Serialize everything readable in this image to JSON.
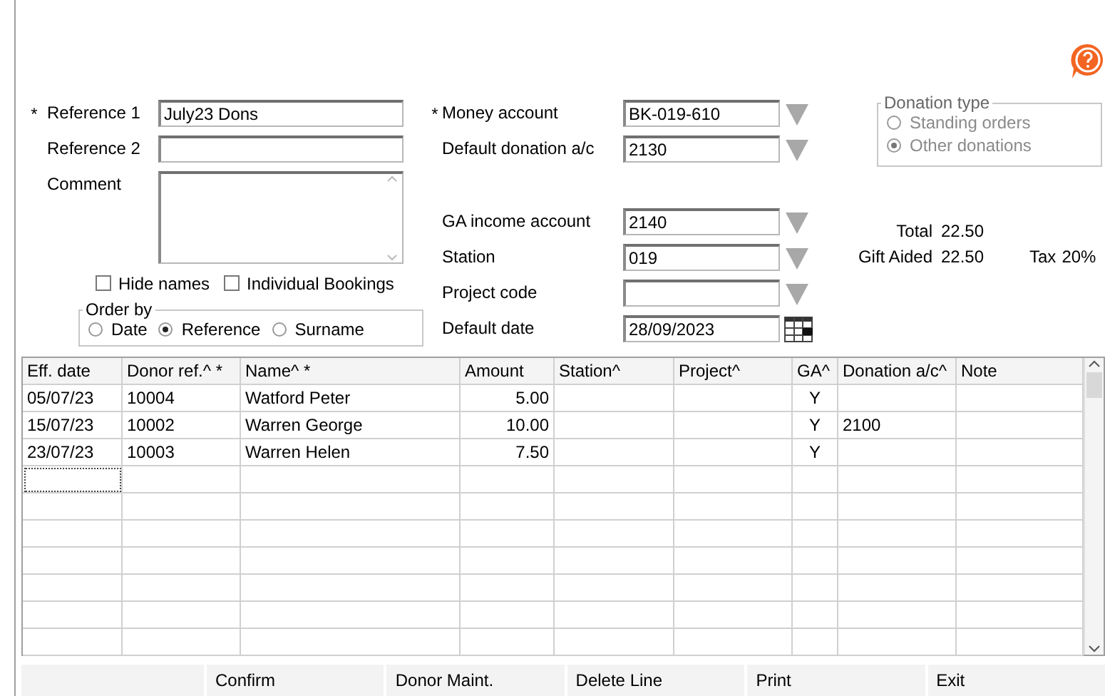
{
  "reference_fields": [
    {
      "kind": "text",
      "label": "Reference 1",
      "marker": "*",
      "value": "July23 Dons"
    },
    {
      "kind": "text",
      "label": "Reference 2"
    },
    {
      "kind": "memo",
      "label": "Comment"
    }
  ],
  "checkboxes": [
    {
      "label": "Hide names",
      "checked": false
    },
    {
      "label": "Individual Bookings",
      "checked": false
    }
  ],
  "order_by": {
    "title": "Order by",
    "options": [
      {
        "label": "Date",
        "selected": false
      },
      {
        "label": "Reference",
        "selected": true
      },
      {
        "label": "Surname",
        "selected": false
      }
    ]
  },
  "account_fields": [
    {
      "kind": "dropdown",
      "label": "Money account",
      "marker": "*",
      "value": "BK-019-610"
    },
    {
      "kind": "dropdown",
      "label": "Default donation a/c",
      "value": "2130"
    }
  ],
  "detail_fields": [
    {
      "kind": "dropdown",
      "label": "GA income account",
      "value": "2140"
    },
    {
      "kind": "dropdown",
      "label": "Station",
      "value": "019"
    },
    {
      "kind": "dropdown",
      "label": "Project code"
    },
    {
      "kind": "date",
      "label": "Default date",
      "value": "28/09/2023"
    }
  ],
  "donation_type": {
    "title": "Donation type",
    "disabled": true,
    "options": [
      {
        "label": "Standing orders",
        "selected": false
      },
      {
        "label": "Other donations",
        "selected": true
      }
    ]
  },
  "totals": {
    "total_label": "Total",
    "total": "22.50",
    "gift_aided_label": "Gift Aided",
    "gift_aided": "22.50",
    "tax_label": "Tax",
    "tax": "20%"
  },
  "table": {
    "columns": [
      {
        "label": "Eff. date",
        "kind": "text"
      },
      {
        "label": "Donor ref.^ *",
        "kind": "text"
      },
      {
        "label": "Name^ *",
        "kind": "text"
      },
      {
        "label": "Amount",
        "kind": "amount"
      },
      {
        "label": "Station^",
        "kind": "text"
      },
      {
        "label": "Project^",
        "kind": "text"
      },
      {
        "label": "GA^",
        "kind": "flag"
      },
      {
        "label": "Donation a/c^",
        "kind": "text"
      },
      {
        "label": "Note",
        "kind": "text"
      }
    ],
    "rows": [
      [
        "05/07/23",
        "10004",
        "Watford Peter",
        "5.00",
        "",
        "",
        "Y",
        "",
        ""
      ],
      [
        "15/07/23",
        "10002",
        "Warren George",
        "10.00",
        "",
        "",
        "Y",
        "2100",
        ""
      ],
      [
        "23/07/23",
        "10003",
        "Warren Helen",
        "7.50",
        "",
        "",
        "Y",
        "",
        ""
      ]
    ],
    "new_row_focused": true
  },
  "buttons": [
    "Confirm",
    "Donor Maint.",
    "Delete Line",
    "Print",
    "Exit"
  ]
}
